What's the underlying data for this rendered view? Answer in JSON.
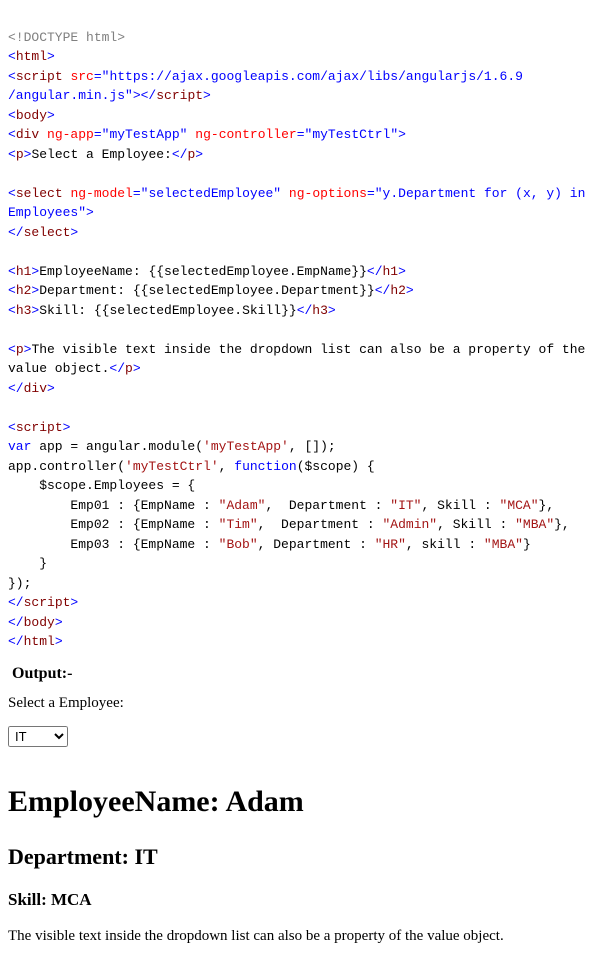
{
  "code": {
    "l1_doctype": "<!DOCTYPE html>",
    "l2_html_open": "html",
    "l3_script": "script",
    "l3_src_attr": "src",
    "l3_src_val": "\"https://ajax.googleapis.com/ajax/libs/angularjs/1.6.9",
    "l4_src_val2": "/angular.min.js\"",
    "l5_body": "body",
    "l6_div": "div",
    "l6_ngapp_attr": "ng-app",
    "l6_ngapp_val": "\"myTestApp\"",
    "l6_ngctrl_attr": "ng-controller",
    "l6_ngctrl_val": "\"myTestCtrl\"",
    "l7_p": "p",
    "l7_text": "Select a Employee:",
    "l9_select": "select",
    "l9_ngmodel_attr": "ng-model",
    "l9_ngmodel_val": "\"selectedEmployee\"",
    "l9_ngopt_attr": "ng-options",
    "l9_ngopt_val": "\"y.Department for (x, y) in",
    "l10_ngopt_val2": "Employees\"",
    "l12_h1": "h1",
    "l12_text": "EmployeeName: {{selectedEmployee.EmpName}}",
    "l13_h2": "h2",
    "l13_text": "Department: {{selectedEmployee.Department}}",
    "l14_h3": "h3",
    "l14_text": "Skill: {{selectedEmployee.Skill}}",
    "l16_p": "p",
    "l16_text": "The visible text inside the dropdown list can also be a property of the",
    "l17_text": "value object.",
    "l20_script": "script",
    "l21": "var",
    "l21b": " app = angular.module(",
    "l21c": "'myTestApp'",
    "l21d": ", []);",
    "l22a": "app.controller(",
    "l22b": "'myTestCtrl'",
    "l22c": ", ",
    "l22d": "function",
    "l22e": "($scope) {",
    "l23": "    $scope.Employees = {",
    "l24a": "        Emp01 : {EmpName : ",
    "l24b": "\"Adam\"",
    "l24c": ",  Department : ",
    "l24d": "\"IT\"",
    "l24e": ", Skill : ",
    "l24f": "\"MCA\"",
    "l24g": "},",
    "l25a": "        Emp02 : {EmpName : ",
    "l25b": "\"Tim\"",
    "l25c": ",  Department : ",
    "l25d": "\"Admin\"",
    "l25e": ", Skill : ",
    "l25f": "\"MBA\"",
    "l25g": "},",
    "l26a": "        Emp03 : {EmpName : ",
    "l26b": "\"Bob\"",
    "l26c": ", Department : ",
    "l26d": "\"HR\"",
    "l26e": ", skill : ",
    "l26f": "\"MBA\"",
    "l26g": "}",
    "l27": "    }",
    "l28": "});"
  },
  "output": {
    "label": "Output:-",
    "select_prompt": "Select a Employee:",
    "selected_option": "IT",
    "h1": "EmployeeName: Adam",
    "h2": "Department: IT",
    "h3": "Skill: MCA",
    "desc": "The visible text inside the dropdown list can also be a property of the value object."
  }
}
